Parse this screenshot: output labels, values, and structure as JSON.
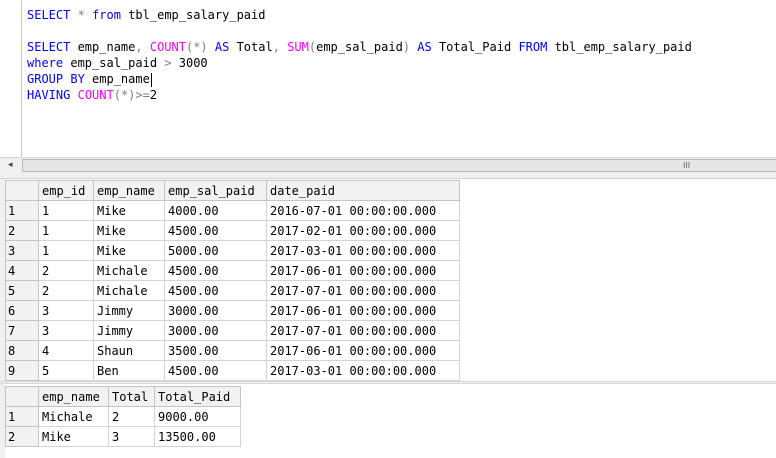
{
  "editor": {
    "lines": [
      [
        {
          "t": "kw",
          "v": "SELECT"
        },
        {
          "t": "tx",
          "v": " "
        },
        {
          "t": "op",
          "v": "*"
        },
        {
          "t": "tx",
          "v": " "
        },
        {
          "t": "kw",
          "v": "from"
        },
        {
          "t": "tx",
          "v": " tbl_emp_salary_paid"
        }
      ],
      [],
      [
        {
          "t": "kw",
          "v": "SELECT"
        },
        {
          "t": "tx",
          "v": " emp_name"
        },
        {
          "t": "op",
          "v": ","
        },
        {
          "t": "tx",
          "v": " "
        },
        {
          "t": "fn",
          "v": "COUNT"
        },
        {
          "t": "op",
          "v": "(*)"
        },
        {
          "t": "tx",
          "v": " "
        },
        {
          "t": "kw",
          "v": "AS"
        },
        {
          "t": "tx",
          "v": " Total"
        },
        {
          "t": "op",
          "v": ","
        },
        {
          "t": "tx",
          "v": " "
        },
        {
          "t": "fn",
          "v": "SUM"
        },
        {
          "t": "op",
          "v": "("
        },
        {
          "t": "tx",
          "v": "emp_sal_paid"
        },
        {
          "t": "op",
          "v": ")"
        },
        {
          "t": "tx",
          "v": " "
        },
        {
          "t": "kw",
          "v": "AS"
        },
        {
          "t": "tx",
          "v": " Total_Paid "
        },
        {
          "t": "kw",
          "v": "FROM"
        },
        {
          "t": "tx",
          "v": " tbl_emp_salary_paid"
        }
      ],
      [
        {
          "t": "kw",
          "v": "where"
        },
        {
          "t": "tx",
          "v": " emp_sal_paid "
        },
        {
          "t": "op",
          "v": ">"
        },
        {
          "t": "tx",
          "v": " 3000"
        }
      ],
      [
        {
          "t": "kw",
          "v": "GROUP BY"
        },
        {
          "t": "tx",
          "v": " emp_name"
        },
        {
          "t": "caret",
          "v": ""
        }
      ],
      [
        {
          "t": "kw",
          "v": "HAVING"
        },
        {
          "t": "tx",
          "v": " "
        },
        {
          "t": "fn",
          "v": "COUNT"
        },
        {
          "t": "op",
          "v": "(*)>="
        },
        {
          "t": "tx",
          "v": "2"
        }
      ]
    ]
  },
  "scrollbar": {
    "left_arrow": "◂",
    "grip": "III"
  },
  "results1": {
    "columns": [
      "emp_id",
      "emp_name",
      "emp_sal_paid",
      "date_paid"
    ],
    "rows": [
      [
        "1",
        "1",
        "Mike",
        "4000.00",
        "2016-07-01 00:00:00.000"
      ],
      [
        "2",
        "1",
        "Mike",
        "4500.00",
        "2017-02-01 00:00:00.000"
      ],
      [
        "3",
        "1",
        "Mike",
        "5000.00",
        "2017-03-01 00:00:00.000"
      ],
      [
        "4",
        "2",
        "Michale",
        "4500.00",
        "2017-06-01 00:00:00.000"
      ],
      [
        "5",
        "2",
        "Michale",
        "4500.00",
        "2017-07-01 00:00:00.000"
      ],
      [
        "6",
        "3",
        "Jimmy",
        "3000.00",
        "2017-06-01 00:00:00.000"
      ],
      [
        "7",
        "3",
        "Jimmy",
        "3000.00",
        "2017-07-01 00:00:00.000"
      ],
      [
        "8",
        "4",
        "Shaun",
        "3500.00",
        "2017-06-01 00:00:00.000"
      ],
      [
        "9",
        "5",
        "Ben",
        "4500.00",
        "2017-03-01 00:00:00.000"
      ]
    ]
  },
  "results2": {
    "columns": [
      "emp_name",
      "Total",
      "Total_Paid"
    ],
    "rows": [
      [
        "1",
        "Michale",
        "2",
        "9000.00"
      ],
      [
        "2",
        "Mike",
        "3",
        "13500.00"
      ]
    ]
  }
}
